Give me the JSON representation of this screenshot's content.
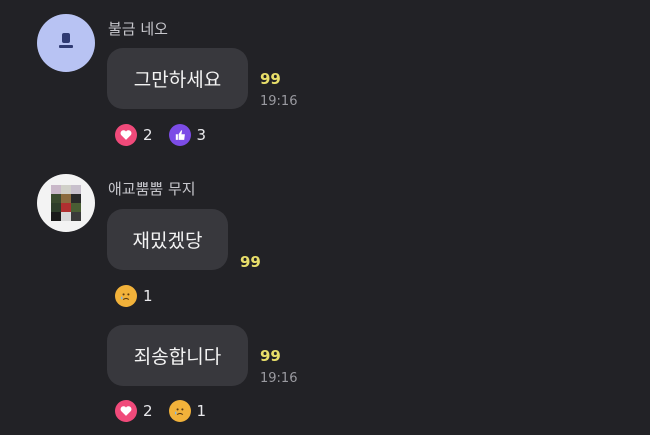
{
  "messages": [
    {
      "sender": "불금 네오",
      "text": "그만하세요",
      "quote": "99",
      "time": "19:16",
      "reactions": [
        {
          "icon": "heart-icon",
          "count": "2",
          "color": "#f04a7a"
        },
        {
          "icon": "thumbs-up-icon",
          "count": "3",
          "color": "#7c4ce6"
        }
      ]
    },
    {
      "sender": "애교뿜뿜 무지",
      "text": "재밌겠당",
      "quote": "99",
      "time": "",
      "reactions": [
        {
          "icon": "sad-face-icon",
          "count": "1",
          "color": "#f2b23a"
        }
      ]
    },
    {
      "text": "죄송합니다",
      "quote": "99",
      "time": "19:16",
      "reactions": [
        {
          "icon": "heart-icon",
          "count": "2",
          "color": "#f04a7a"
        },
        {
          "icon": "sad-face-icon",
          "count": "1",
          "color": "#f2b23a"
        }
      ]
    }
  ]
}
